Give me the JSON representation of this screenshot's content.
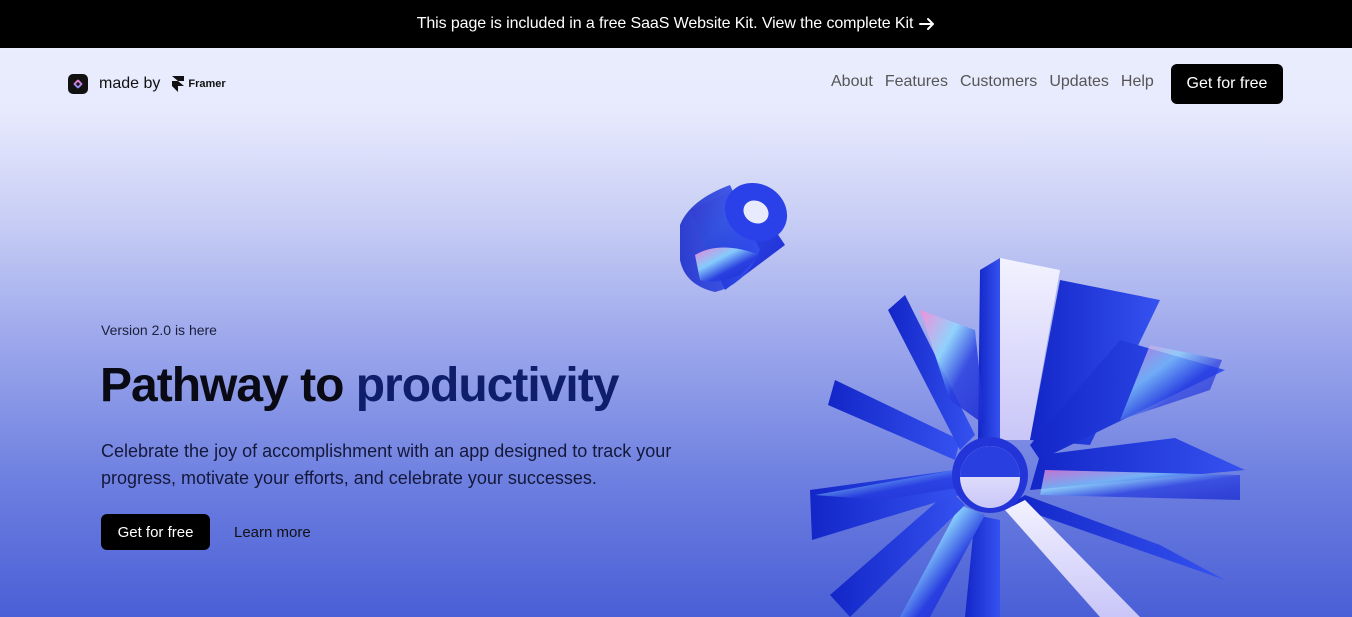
{
  "banner": {
    "text": "This page is included in a free SaaS Website Kit. View the complete Kit",
    "icon": "arrow-right-icon"
  },
  "brand": {
    "made_by": "made by",
    "framer": "Framer",
    "logo_icon": "app-logo-icon"
  },
  "nav": {
    "links": [
      "About",
      "Features",
      "Customers",
      "Updates",
      "Help"
    ],
    "cta": "Get for free"
  },
  "hero": {
    "eyebrow": "Version 2.0 is here",
    "headline_part1": "Pathway to ",
    "headline_accent": "productivity",
    "subtext": "Celebrate the joy of accomplishment with an app designed to track your progress, motivate your efforts, and celebrate your successes.",
    "primary_cta": "Get for free",
    "secondary_cta": "Learn more"
  },
  "colors": {
    "banner_bg": "#000000",
    "accent_text": "#0f1e6b",
    "cta_bg": "#000000",
    "gradient_top": "#eceffd",
    "gradient_bottom": "#4a5fd6"
  }
}
